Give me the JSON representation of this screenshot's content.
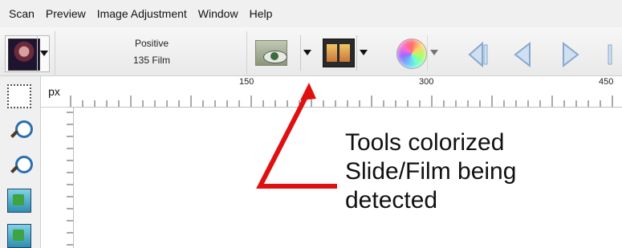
{
  "menu": {
    "items": [
      "Scan",
      "Preview",
      "Image Adjustment",
      "Window",
      "Help"
    ]
  },
  "toolbar": {
    "film_mode_line1": "Positive",
    "film_mode_line2": "135 Film",
    "icons": [
      "film-thumbnail-icon",
      "eye-icon",
      "film-strip-icon",
      "color-wheel-icon",
      "skip-back-icon",
      "back-icon",
      "forward-icon"
    ]
  },
  "ruler": {
    "unit": "px",
    "labels": [
      "150",
      "300",
      "450"
    ]
  },
  "annotation": {
    "text": "Tools colorized\nSlide/Film being\ndetected",
    "arrow_color": "#e01010"
  },
  "colors": {
    "menu_bg": "#f0f0f0",
    "annotation_arrow": "#e01010"
  }
}
